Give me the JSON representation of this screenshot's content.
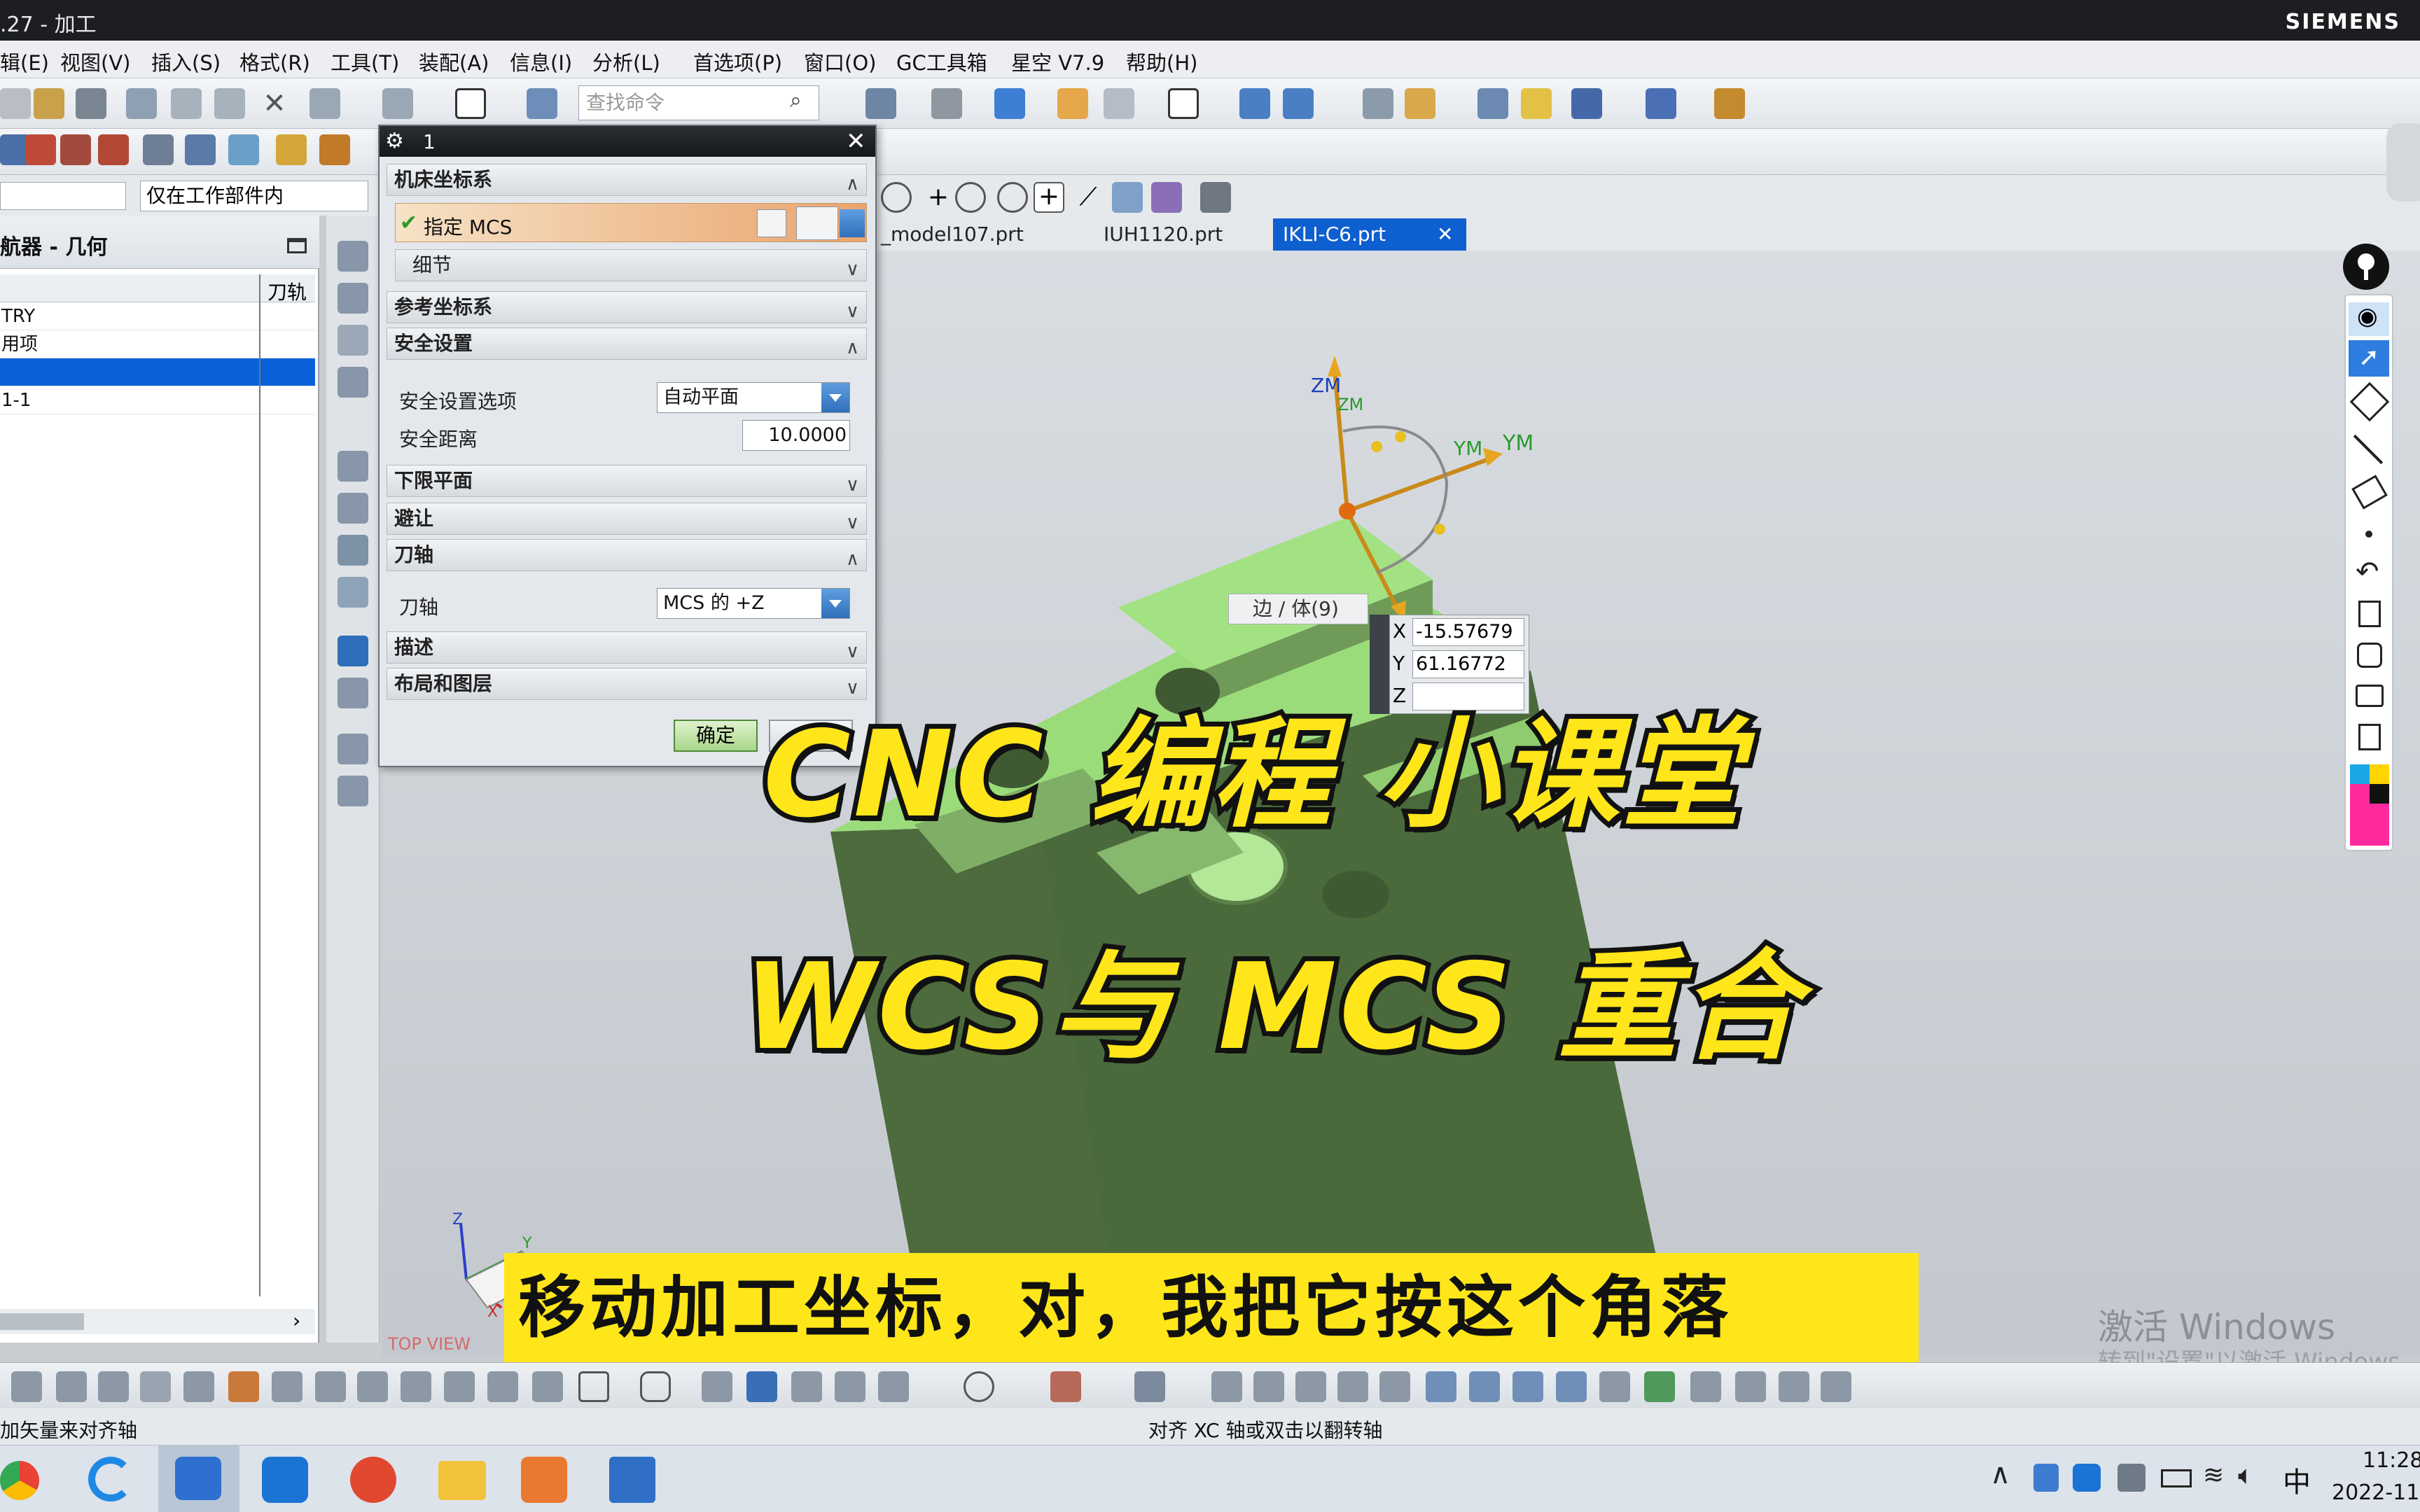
{
  "window": {
    "title": ".27 - 加工",
    "brand": "SIEMENS"
  },
  "menu": [
    "辑(E)",
    "视图(V)",
    "插入(S)",
    "格式(R)",
    "工具(T)",
    "装配(A)",
    "信息(I)",
    "分析(L)",
    "首选项(P)",
    "窗口(O)",
    "GC工具箱",
    "星空 V7.9",
    "帮助(H)"
  ],
  "search": {
    "placeholder": "查找命令"
  },
  "filter": {
    "value": "仅在工作部件内"
  },
  "navigator": {
    "title": "航器 - 几何",
    "column": "刀轨",
    "rows": [
      "TRY",
      "用项",
      "",
      "1-1"
    ]
  },
  "tabs": [
    "_model107.prt",
    "IUH1120.prt",
    "IKLI-C6.prt"
  ],
  "dialog": {
    "title": "1",
    "sec_mcs": "机床坐标系",
    "specify_mcs": "指定 MCS",
    "details": "细节",
    "sec_ref": "参考坐标系",
    "sec_safe": "安全设置",
    "safe_opt_label": "安全设置选项",
    "safe_opt_value": "自动平面",
    "safe_dist_label": "安全距离",
    "safe_dist_value": "10.0000",
    "sec_lower": "下限平面",
    "sec_avoid": "避让",
    "sec_axis": "刀轴",
    "axis_label": "刀轴",
    "axis_value": "MCS 的 +Z",
    "sec_desc": "描述",
    "sec_layout": "布局和图层",
    "ok": "确定"
  },
  "viewport": {
    "zm": "ZM",
    "ym": "YM",
    "snap_label": "边 / 体(9)",
    "x_label": "X",
    "x_value": "-15.57679",
    "y_label": "Y",
    "y_value": "61.16772",
    "z_label": "Z",
    "view_name": "TOP VIEW",
    "axis_z": "Z",
    "axis_y": "Y",
    "axis_x": "X"
  },
  "overlay": {
    "title1": "CNC 编程 小课堂",
    "title2": "WCS与 MCS 重合",
    "subtitle": "移动加工坐标，对，我把它按这个角落"
  },
  "watermark": {
    "line1": "激活 Windows",
    "line2": "转到\"设置\"以激活 Windows。"
  },
  "status": {
    "left": "加矢量来对齐轴",
    "center": "对齐 XC 轴或双击以翻转轴"
  },
  "clock": {
    "time": "11:28",
    "date": "2022-11",
    "ime": "中"
  },
  "colors": {
    "part_green": "#9bdc7a",
    "accent_blue": "#0a62d8",
    "overlay_yellow": "#ffe61a"
  }
}
